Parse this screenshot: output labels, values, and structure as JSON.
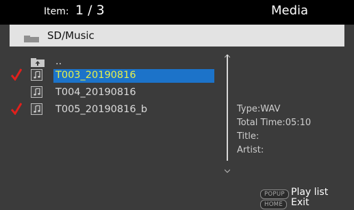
{
  "header": {
    "item_label": "Item:",
    "item_count": "1 / 3",
    "title": "Media"
  },
  "path": {
    "icon": "folder-icon",
    "text": "SD/Music"
  },
  "list": {
    "parent": {
      "icon": "parent-folder-icon",
      "label": ".."
    },
    "items": [
      {
        "label": "T003_20190816",
        "icon": "music-file-icon",
        "checked": true,
        "selected": true
      },
      {
        "label": "T004_20190816",
        "icon": "music-file-icon",
        "checked": false,
        "selected": false
      },
      {
        "label": "T005_20190816_b",
        "icon": "music-file-icon",
        "checked": true,
        "selected": false
      }
    ]
  },
  "info": {
    "type": "Type:WAV",
    "total_time": "Total Time:05:10",
    "title": "Title:",
    "artist": "Artist:"
  },
  "keys": {
    "popup_badge": "POPUP",
    "popup_label": "Play list",
    "home_badge": "HOME",
    "home_label": "Exit"
  },
  "colors": {
    "background": "#3b3b3b",
    "header_bg": "#000000",
    "path_bar_bg": "#e3e3e3",
    "selection_bg": "#1c73c9",
    "selection_text": "#e8f04a",
    "check_mark": "#e0201c"
  }
}
